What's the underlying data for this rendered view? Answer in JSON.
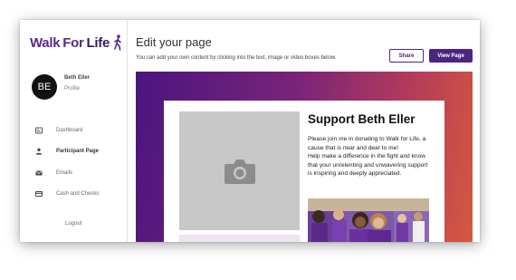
{
  "sidebar": {
    "logo": {
      "walk": "Walk",
      "for": "For",
      "life": "Life"
    },
    "user": {
      "initials": "BE",
      "name": "Beth Eller",
      "profile_link": "Profile"
    },
    "nav": [
      {
        "icon": "dashboard-icon",
        "label": "Dashboard",
        "active": false
      },
      {
        "icon": "user-icon",
        "label": "Participant Page",
        "active": true
      },
      {
        "icon": "mail-icon",
        "label": "Emails",
        "active": false
      },
      {
        "icon": "card-icon",
        "label": "Cash and Checks",
        "active": false
      }
    ],
    "logout": "Logout"
  },
  "main": {
    "title": "Edit your page",
    "subtitle": "You can add your own content by clicking into the text, image or video boxes below.",
    "share_label": "Share",
    "view_label": "View Page",
    "card": {
      "title": "Support Beth Eller",
      "paragraph1": "Please join me in donating to Walk for Life, a cause that is near and dear to me!",
      "paragraph2": "Help make a difference in the fight and know that your unrelenting and unwavering support is inspiring and deeply appreciated."
    }
  },
  "colors": {
    "brand": "#4b2580",
    "gradient_start": "#4a1580",
    "gradient_end": "#d5593e"
  }
}
